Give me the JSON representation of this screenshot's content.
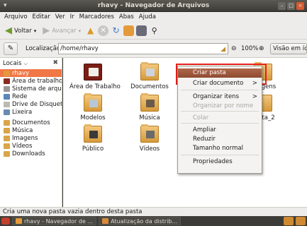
{
  "window": {
    "title": "rhavy - Navegador de Arquivos"
  },
  "menu": [
    "Arquivo",
    "Editar",
    "Ver",
    "Ir",
    "Marcadores",
    "Abas",
    "Ajuda"
  ],
  "toolbar": {
    "back_label": "Voltar",
    "forward_label": "Avançar"
  },
  "location": {
    "label": "Localização:",
    "path": "/home/rhavy",
    "zoom": "100%",
    "view_mode": "Visão em ícones"
  },
  "sidebar": {
    "header": "Locais",
    "items": [
      {
        "label": "rhavy",
        "selected": true,
        "color": "#e49a3a"
      },
      {
        "label": "Área de trabalho",
        "color": "#8a2a1e"
      },
      {
        "label": "Sistema de arqu...",
        "color": "#9a9894"
      },
      {
        "label": "Rede",
        "color": "#5a86b8"
      },
      {
        "label": "Drive de Disquete",
        "color": "#bdbab3"
      },
      {
        "label": "Lixeira",
        "color": "#6a8ab0"
      },
      {
        "label": "Documentos",
        "color": "#d9a548"
      },
      {
        "label": "Música",
        "color": "#d9a548"
      },
      {
        "label": "Imagens",
        "color": "#d9a548"
      },
      {
        "label": "Vídeos",
        "color": "#d9a548"
      },
      {
        "label": "Downloads",
        "color": "#d9a548"
      }
    ]
  },
  "files": [
    {
      "label": "Área de Trabalho",
      "kind": "desktop"
    },
    {
      "label": "Documentos",
      "kind": "folder"
    },
    {
      "label": "Imagens",
      "kind": "folder"
    },
    {
      "label": "Modelos",
      "kind": "folder"
    },
    {
      "label": "Música",
      "kind": "folder"
    },
    {
      "label": "pasta_2",
      "kind": "folder"
    },
    {
      "label": "Público",
      "kind": "folder"
    },
    {
      "label": "Vídeos",
      "kind": "folder"
    }
  ],
  "context_menu": {
    "items": [
      {
        "label": "Criar pasta",
        "highlighted": true
      },
      {
        "label": "Criar documento",
        "submenu": true
      },
      {
        "label": "Organizar itens",
        "submenu": true
      },
      {
        "label": "Organizar por nome",
        "disabled": true
      },
      {
        "label": "Colar",
        "disabled": true
      },
      {
        "label": "Ampliar"
      },
      {
        "label": "Reduzir"
      },
      {
        "label": "Tamanho normal"
      },
      {
        "label": "Propriedades"
      }
    ]
  },
  "status": "Cria uma nova pasta vazia dentro desta pasta",
  "taskbar": {
    "items": [
      "rhavy - Navegador de ...",
      "Atualização da distrib..."
    ]
  },
  "colors": {
    "accent": "#f07746",
    "menu_highlight": "#9e573d",
    "annotation": "#e5201b"
  }
}
